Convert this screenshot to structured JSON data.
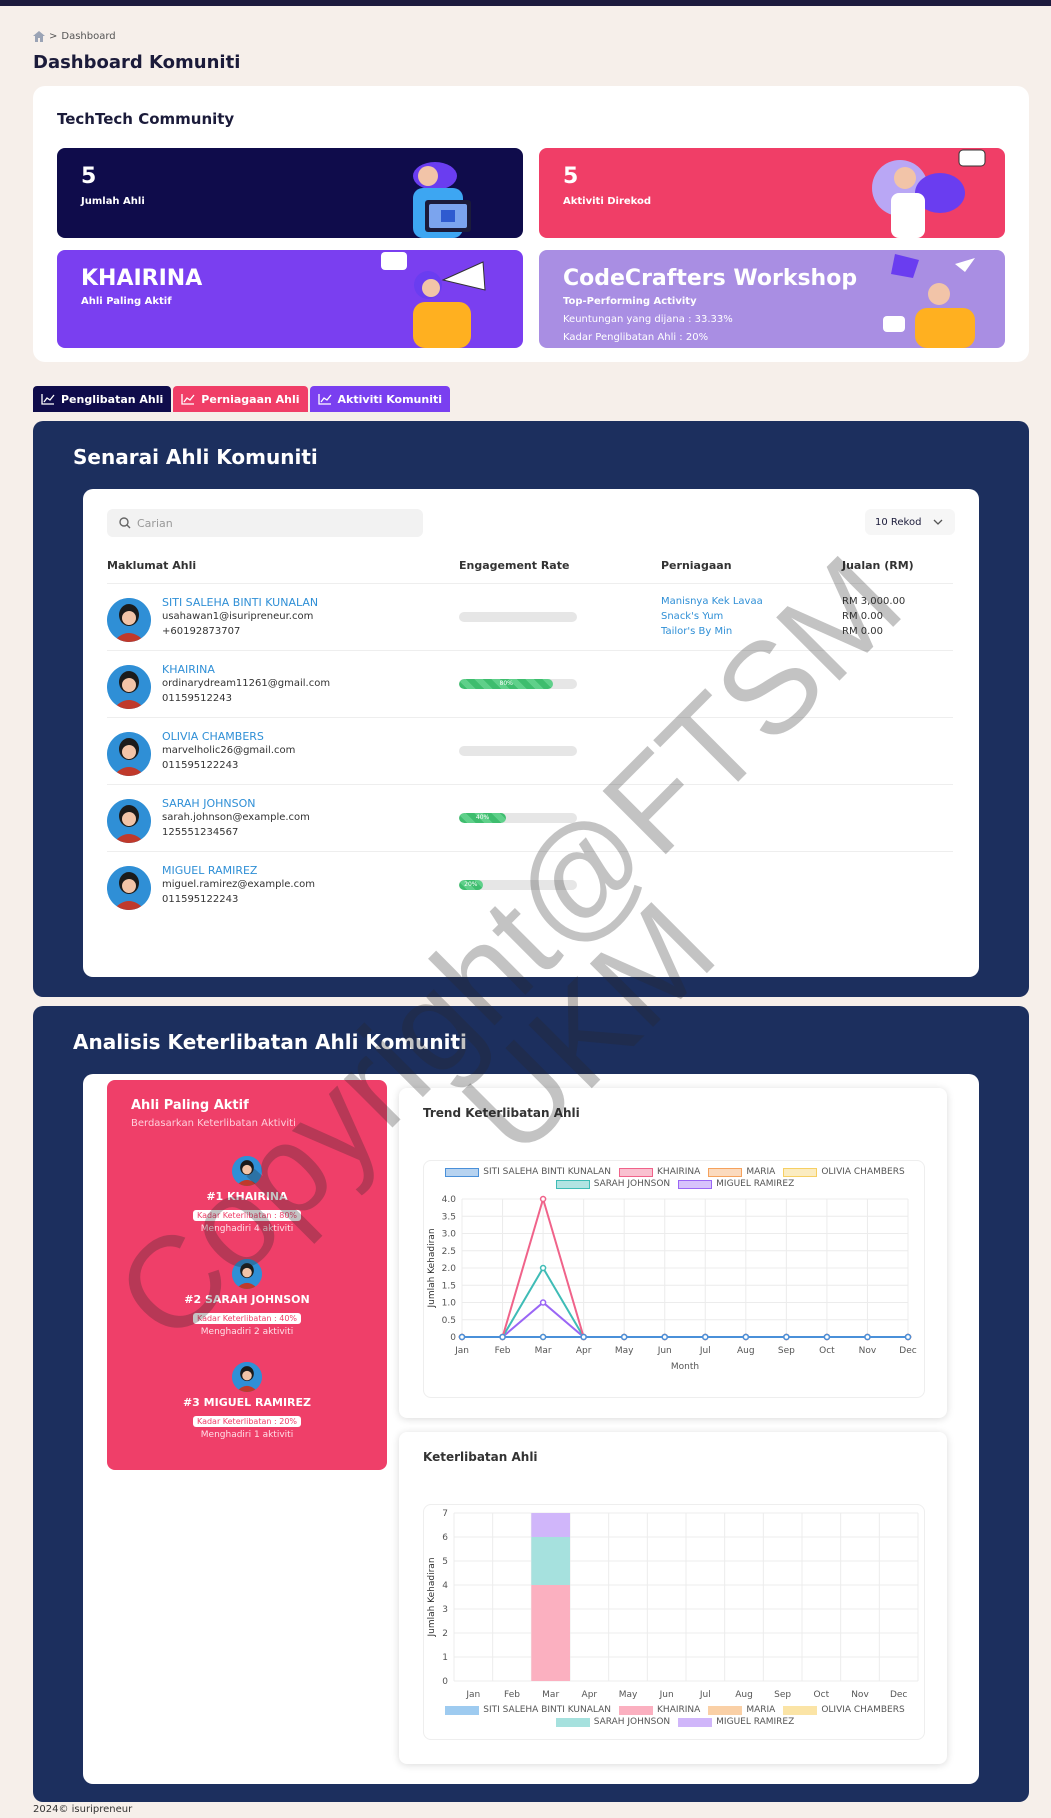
{
  "breadcrumb": {
    "home_icon": "home-icon",
    "current": "Dashboard"
  },
  "page_title": "Dashboard Komuniti",
  "community": {
    "name": "TechTech Community",
    "cards": {
      "members": {
        "value": "5",
        "label": "Jumlah Ahli",
        "color": "#0f0c4b"
      },
      "activities": {
        "value": "5",
        "label": "Aktiviti Direkod",
        "color": "#f03e67"
      },
      "most_active": {
        "value": "KHAIRINA",
        "label": "Ahli Paling Aktif",
        "color": "#7a3ff0"
      },
      "workshop": {
        "value": "CodeCrafters Workshop",
        "label": "Top-Performing Activity",
        "profit": "Keuntungan yang dijana : 33.33%",
        "engagement": "Kadar Penglibatan Ahli : 20%",
        "color": "#a98ee3"
      }
    }
  },
  "tabs": [
    {
      "label": "Penglibatan Ahli",
      "color": "#0f0c4b"
    },
    {
      "label": "Perniagaan Ahli",
      "color": "#f03e67"
    },
    {
      "label": "Aktiviti Komuniti",
      "color": "#7a3ff0"
    }
  ],
  "members_panel": {
    "title": "Senarai Ahli Komuniti",
    "search_placeholder": "Carian",
    "rekod": "10 Rekod",
    "headers": {
      "info": "Maklumat Ahli",
      "engagement": "Engagement Rate",
      "business": "Perniagaan",
      "sales": "Jualan (RM)"
    },
    "rows": [
      {
        "name": "SITI SALEHA BINTI KUNALAN",
        "email": "usahawan1@isuripreneur.com",
        "phone": "+60192873707",
        "rate": 0,
        "rate_label": "",
        "businesses": [
          "Manisnya Kek Lavaa",
          "Snack's Yum",
          "Tailor's By Min"
        ],
        "sales": [
          "RM 3,000.00",
          "RM 0.00",
          "RM 0.00"
        ]
      },
      {
        "name": "KHAIRINA",
        "email": "ordinarydream11261@gmail.com",
        "phone": "01159512243",
        "rate": 80,
        "rate_label": "80%",
        "businesses": [],
        "sales": []
      },
      {
        "name": "OLIVIA CHAMBERS",
        "email": "marvelholic26@gmail.com",
        "phone": "011595122243",
        "rate": 0,
        "rate_label": "",
        "businesses": [],
        "sales": []
      },
      {
        "name": "SARAH JOHNSON",
        "email": "sarah.johnson@example.com",
        "phone": "125551234567",
        "rate": 40,
        "rate_label": "40%",
        "businesses": [],
        "sales": []
      },
      {
        "name": "MIGUEL RAMIREZ",
        "email": "miguel.ramirez@example.com",
        "phone": "011595122243",
        "rate": 20,
        "rate_label": "20%",
        "businesses": [],
        "sales": []
      }
    ]
  },
  "analysis_panel": {
    "title": "Analisis Keterlibatan Ahli Komuniti",
    "most_active": {
      "title": "Ahli Paling Aktif",
      "subtitle": "Berdasarkan Keterlibatan Aktiviti",
      "ranks": [
        {
          "name": "#1 KHAIRINA",
          "rate": "Kadar Keterlibatan : 80%",
          "attend": "Menghadiri 4 aktiviti"
        },
        {
          "name": "#2 SARAH JOHNSON",
          "rate": "Kadar Keterlibatan : 40%",
          "attend": "Menghadiri 2 aktiviti"
        },
        {
          "name": "#3 MIGUEL RAMIREZ",
          "rate": "Kadar Keterlibatan : 20%",
          "attend": "Menghadiri 1 aktiviti"
        }
      ]
    }
  },
  "chart_data": [
    {
      "type": "line",
      "title": "Trend Keterlibatan Ahli",
      "xlabel": "Month",
      "ylabel": "Jumlah Kehadiran",
      "ylim": [
        0,
        4
      ],
      "yticks": [
        "0",
        "0.5",
        "1.0",
        "1.5",
        "2.0",
        "2.5",
        "3.0",
        "3.5",
        "4.0"
      ],
      "categories": [
        "Jan",
        "Feb",
        "Mar",
        "Apr",
        "May",
        "Jun",
        "Jul",
        "Aug",
        "Sep",
        "Oct",
        "Nov",
        "Dec"
      ],
      "legend_position": "top",
      "series": [
        {
          "name": "SITI SALEHA BINTI KUNALAN",
          "color": "#4a90d9",
          "values": [
            0,
            0,
            0,
            0,
            0,
            0,
            0,
            0,
            0,
            0,
            0,
            0
          ]
        },
        {
          "name": "KHAIRINA",
          "color": "#f0638a",
          "values": [
            0,
            0,
            4,
            0,
            0,
            0,
            0,
            0,
            0,
            0,
            0,
            0
          ]
        },
        {
          "name": "MARIA",
          "color": "#f5a25d",
          "values": [
            0,
            0,
            0,
            0,
            0,
            0,
            0,
            0,
            0,
            0,
            0,
            0
          ]
        },
        {
          "name": "OLIVIA CHAMBERS",
          "color": "#f6cf63",
          "values": [
            0,
            0,
            0,
            0,
            0,
            0,
            0,
            0,
            0,
            0,
            0,
            0
          ]
        },
        {
          "name": "SARAH JOHNSON",
          "color": "#3fbcb6",
          "values": [
            0,
            0,
            2,
            0,
            0,
            0,
            0,
            0,
            0,
            0,
            0,
            0
          ]
        },
        {
          "name": "MIGUEL RAMIREZ",
          "color": "#9a66f5",
          "values": [
            0,
            0,
            1,
            0,
            0,
            0,
            0,
            0,
            0,
            0,
            0,
            0
          ]
        }
      ]
    },
    {
      "type": "bar",
      "stacked": true,
      "title": "Keterlibatan Ahli",
      "ylabel": "Jumlah Kehadiran",
      "ylim": [
        0,
        7
      ],
      "yticks": [
        "0",
        "1",
        "2",
        "3",
        "4",
        "5",
        "6",
        "7"
      ],
      "categories": [
        "Jan",
        "Feb",
        "Mar",
        "Apr",
        "May",
        "Jun",
        "Jul",
        "Aug",
        "Sep",
        "Oct",
        "Nov",
        "Dec"
      ],
      "legend_position": "bottom",
      "series": [
        {
          "name": "SITI SALEHA BINTI KUNALAN",
          "color": "#9ecbf0",
          "values": [
            0,
            0,
            0,
            0,
            0,
            0,
            0,
            0,
            0,
            0,
            0,
            0
          ]
        },
        {
          "name": "KHAIRINA",
          "color": "#fbb0c0",
          "values": [
            0,
            0,
            4,
            0,
            0,
            0,
            0,
            0,
            0,
            0,
            0,
            0
          ]
        },
        {
          "name": "MARIA",
          "color": "#fad0a6",
          "values": [
            0,
            0,
            0,
            0,
            0,
            0,
            0,
            0,
            0,
            0,
            0,
            0
          ]
        },
        {
          "name": "OLIVIA CHAMBERS",
          "color": "#fbe4a6",
          "values": [
            0,
            0,
            0,
            0,
            0,
            0,
            0,
            0,
            0,
            0,
            0,
            0
          ]
        },
        {
          "name": "SARAH JOHNSON",
          "color": "#a6e1de",
          "values": [
            0,
            0,
            2,
            0,
            0,
            0,
            0,
            0,
            0,
            0,
            0,
            0
          ]
        },
        {
          "name": "MIGUEL RAMIREZ",
          "color": "#d0b6fa",
          "values": [
            0,
            0,
            1,
            0,
            0,
            0,
            0,
            0,
            0,
            0,
            0,
            0
          ]
        }
      ]
    }
  ],
  "watermark": [
    "Copyright@FTSM",
    "UKM"
  ],
  "footer": "2024© isuripreneur"
}
